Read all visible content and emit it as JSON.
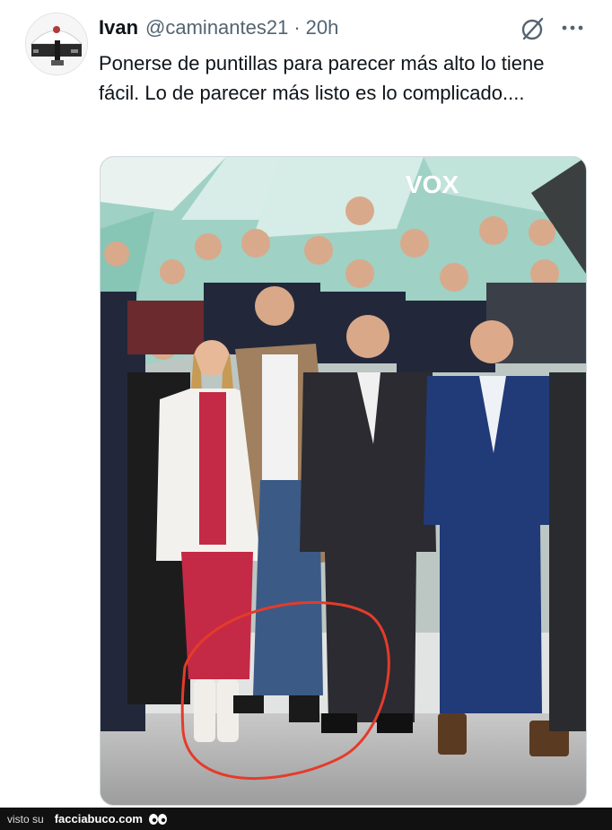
{
  "tweet": {
    "author_name": "Ivan",
    "handle": "@caminantes21",
    "separator": "·",
    "time": "20h",
    "text": "Ponerse de puntillas para parecer más alto lo tiene fácil. Lo de parecer más listo es lo complicado....",
    "icons": [
      "grok-icon",
      "more-icon"
    ],
    "media_sign": "VOX",
    "highlight_color": "#e43b2b"
  },
  "footer": {
    "visto_label": "visto su",
    "site": "facciabuco.com"
  }
}
